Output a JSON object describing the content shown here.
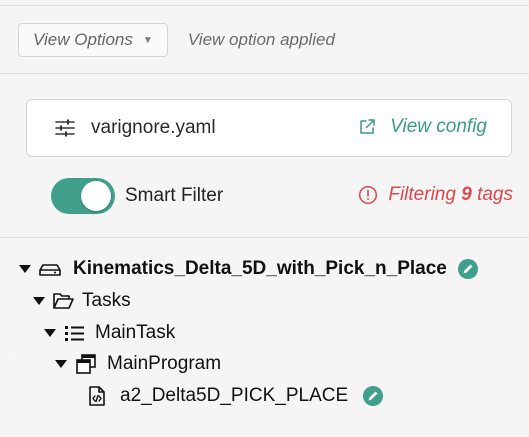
{
  "toolbar": {
    "view_options_label": "View Options",
    "view_status": "View option applied"
  },
  "config": {
    "icon": "sliders-icon",
    "filename": "varignore.yaml",
    "link_icon": "external-link-icon",
    "link_label": "View config"
  },
  "filter": {
    "toggle_on": true,
    "label": "Smart Filter",
    "status_prefix": "Filtering",
    "status_count": "9",
    "status_suffix": "tags"
  },
  "tree": {
    "root": {
      "label": "Kinematics_Delta_5D_with_Pick_n_Place",
      "icon": "drive-icon",
      "expanded": true
    },
    "tasks": {
      "label": "Tasks",
      "icon": "folder-open-icon",
      "expanded": true
    },
    "main_task": {
      "label": "MainTask",
      "icon": "list-icon",
      "expanded": true
    },
    "main_program": {
      "label": "MainProgram",
      "icon": "program-window-icon",
      "expanded": true
    },
    "routine": {
      "label": "a2_Delta5D_PICK_PLACE",
      "icon": "code-file-icon"
    }
  },
  "colors": {
    "accent": "#3f9f8a",
    "error": "#e0464b",
    "background": "#f5f5f5"
  }
}
